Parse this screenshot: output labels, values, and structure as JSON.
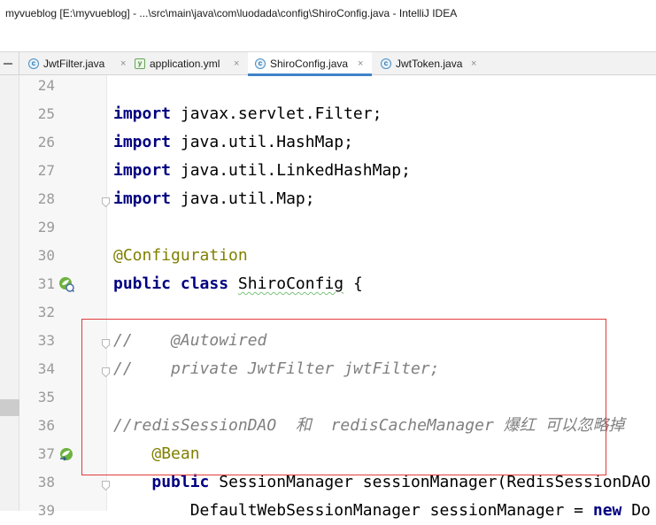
{
  "window": {
    "title": "myvueblog [E:\\myvueblog] - ...\\src\\main\\java\\com\\luodada\\config\\ShiroConfig.java - IntelliJ IDEA"
  },
  "tabs": [
    {
      "label": "JwtFilter.java",
      "icon": "java-class-icon",
      "active": false
    },
    {
      "label": "application.yml",
      "icon": "yml-file-icon",
      "active": false
    },
    {
      "label": "ShiroConfig.java",
      "icon": "java-class-icon",
      "active": true
    },
    {
      "label": "JwtToken.java",
      "icon": "java-class-icon",
      "active": false
    }
  ],
  "tab_close_glyph": "×",
  "code_lines": [
    {
      "num": "24",
      "kind": "blank",
      "parts": []
    },
    {
      "num": "25",
      "kind": "import",
      "parts": [
        {
          "t": "import",
          "c": "kw"
        },
        {
          "t": " javax.servlet.Filter;",
          "c": ""
        }
      ]
    },
    {
      "num": "26",
      "kind": "import",
      "parts": [
        {
          "t": "import",
          "c": "kw"
        },
        {
          "t": " java.util.HashMap;",
          "c": ""
        }
      ]
    },
    {
      "num": "27",
      "kind": "import",
      "parts": [
        {
          "t": "import",
          "c": "kw"
        },
        {
          "t": " java.util.LinkedHashMap;",
          "c": ""
        }
      ]
    },
    {
      "num": "28",
      "kind": "import",
      "parts": [
        {
          "t": "import",
          "c": "kw"
        },
        {
          "t": " java.util.Map;",
          "c": ""
        }
      ]
    },
    {
      "num": "29",
      "kind": "blank",
      "parts": []
    },
    {
      "num": "30",
      "kind": "annotation",
      "parts": [
        {
          "t": "@Configuration",
          "c": "ann"
        }
      ]
    },
    {
      "num": "31",
      "kind": "class",
      "parts": [
        {
          "t": "public",
          "c": "kw"
        },
        {
          "t": " ",
          "c": ""
        },
        {
          "t": "class",
          "c": "kw"
        },
        {
          "t": " ",
          "c": ""
        },
        {
          "t": "ShiroConfig",
          "c": "wavy"
        },
        {
          "t": " {",
          "c": ""
        }
      ]
    },
    {
      "num": "32",
      "kind": "blank",
      "parts": []
    },
    {
      "num": "33",
      "kind": "comment",
      "parts": [
        {
          "t": "//    @Autowired",
          "c": "cm"
        }
      ]
    },
    {
      "num": "34",
      "kind": "comment",
      "parts": [
        {
          "t": "//    private JwtFilter jwtFilter;",
          "c": "cm"
        }
      ]
    },
    {
      "num": "35",
      "kind": "blank",
      "parts": []
    },
    {
      "num": "36",
      "kind": "comment",
      "parts": [
        {
          "t": "//redisSessionDAO  和  redisCacheManager 爆红 可以忽略掉",
          "c": "cm"
        }
      ]
    },
    {
      "num": "37",
      "kind": "annotation",
      "parts": [
        {
          "t": "    ",
          "c": ""
        },
        {
          "t": "@Bean",
          "c": "ann"
        }
      ]
    },
    {
      "num": "38",
      "kind": "method",
      "parts": [
        {
          "t": "    ",
          "c": ""
        },
        {
          "t": "public",
          "c": "kw"
        },
        {
          "t": " SessionManager sessionManager(RedisSessionDAO",
          "c": ""
        }
      ]
    },
    {
      "num": "39",
      "kind": "statement",
      "parts": [
        {
          "t": "        DefaultWebSessionManager sessionManager = ",
          "c": ""
        },
        {
          "t": "new",
          "c": "kw"
        },
        {
          "t": " Do",
          "c": ""
        }
      ]
    }
  ],
  "gutter_icons": [
    {
      "line": "31",
      "name": "spring-bean-icon"
    },
    {
      "line": "37",
      "name": "spring-bean-navigate-icon"
    }
  ],
  "fold_markers": [
    "28",
    "33",
    "34",
    "38"
  ],
  "colors": {
    "keyword": "#000080",
    "annotation": "#808000",
    "comment": "#808080",
    "highlight_box": "#e33b3b",
    "active_tab_underline": "#4083c9"
  }
}
